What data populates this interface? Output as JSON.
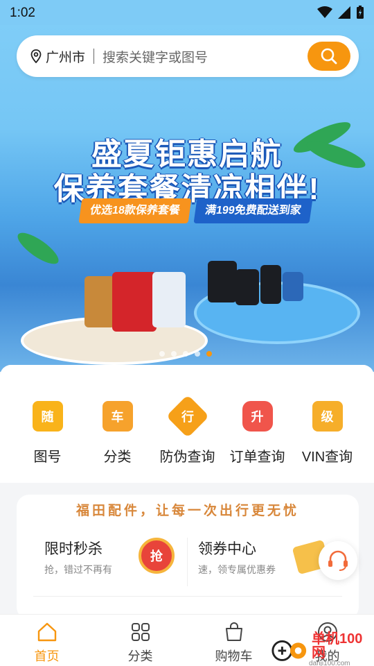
{
  "status_bar": {
    "time": "1:02"
  },
  "search": {
    "city": "广州市",
    "placeholder": "搜索关键字或图号"
  },
  "banner": {
    "title_line1": "盛夏钜惠启航",
    "title_line2": "保养套餐清凉相伴!",
    "tag_left": "优选18款保养套餐",
    "tag_right": "满199免费配送到家",
    "indicator_total": 5,
    "indicator_active": 5
  },
  "quick_entries": [
    {
      "icon_char": "随",
      "label": "图号",
      "color": "#f9b31a"
    },
    {
      "icon_char": "车",
      "label": "分类",
      "color": "#f6a22c"
    },
    {
      "icon_char": "行",
      "label": "防伪查询",
      "color": "#f6a019"
    },
    {
      "icon_char": "升",
      "label": "订单查询",
      "color": "#f0554b"
    },
    {
      "icon_char": "级",
      "label": "VIN查询",
      "color": "#f6ae2a"
    }
  ],
  "promo": {
    "slogan": "福田配件，让每一次出行更无忧",
    "left": {
      "title": "限时秒杀",
      "subtitle": "抢，错过不再有",
      "badge": "抢"
    },
    "right": {
      "title": "领券中心",
      "subtitle": "速，领专属优惠券"
    }
  },
  "tabs": [
    {
      "label": "首页",
      "icon": "home-icon",
      "active": true
    },
    {
      "label": "分类",
      "icon": "grid-icon",
      "active": false
    },
    {
      "label": "购物车",
      "icon": "shopping-bag-icon",
      "active": false
    },
    {
      "label": "我的",
      "icon": "user-icon",
      "active": false
    }
  ],
  "watermark": {
    "text": "单机100网",
    "sub": "danji100.com"
  },
  "colors": {
    "accent": "#f7960f",
    "sky": "#7ecbf6"
  }
}
